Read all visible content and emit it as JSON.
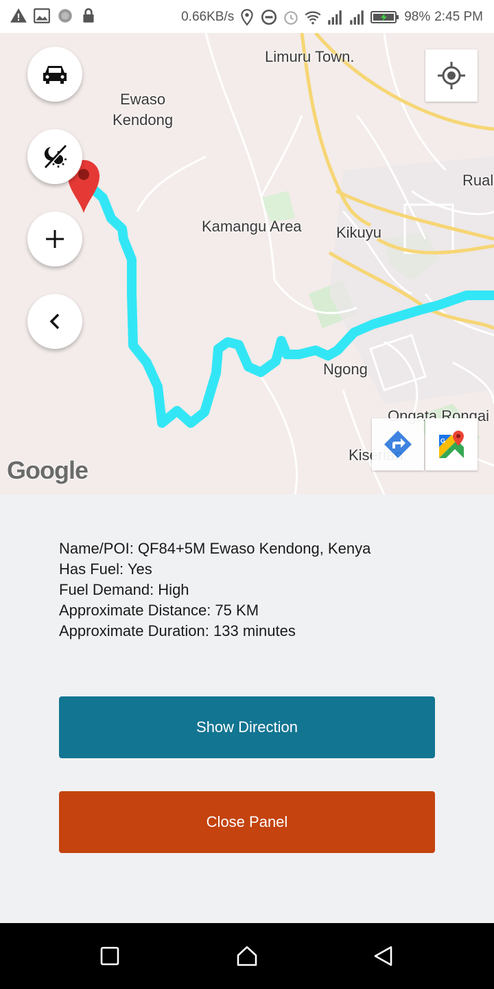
{
  "status_bar": {
    "speed": "0.66KB/s",
    "battery": "98%",
    "time": "2:45 PM"
  },
  "map": {
    "labels": {
      "limuru": "Limuru Town.",
      "ewaso": "Ewaso\nKendong",
      "rual": "Rual",
      "kamangu": "Kamangu Area",
      "kikuyu": "Kikuyu",
      "ngong": "Ngong",
      "ongata": "Ongata Rongai",
      "kiserian": "Kiserian"
    },
    "logo": "Google",
    "route_color": "#33e6f5",
    "marker_color": "#e53935"
  },
  "controls": {
    "vehicle_icon": "car-icon",
    "day_night_icon": "day-night-icon",
    "zoom_icon": "plus-icon",
    "collapse_icon": "chevron-left-icon",
    "locate_icon": "my-location-icon",
    "directions_icon": "directions-icon",
    "maps_icon": "google-maps-icon"
  },
  "details": {
    "name": "Name/POI: QF84+5M Ewaso Kendong, Kenya",
    "fuel": "Has Fuel: Yes",
    "demand": "Fuel Demand: High",
    "distance": "Approximate Distance: 75 KM",
    "duration": "Approximate Duration: 133 minutes"
  },
  "buttons": {
    "show_direction": "Show Direction",
    "close_panel": "Close Panel"
  },
  "colors": {
    "direction_button": "#127592",
    "close_button": "#c4430e"
  }
}
